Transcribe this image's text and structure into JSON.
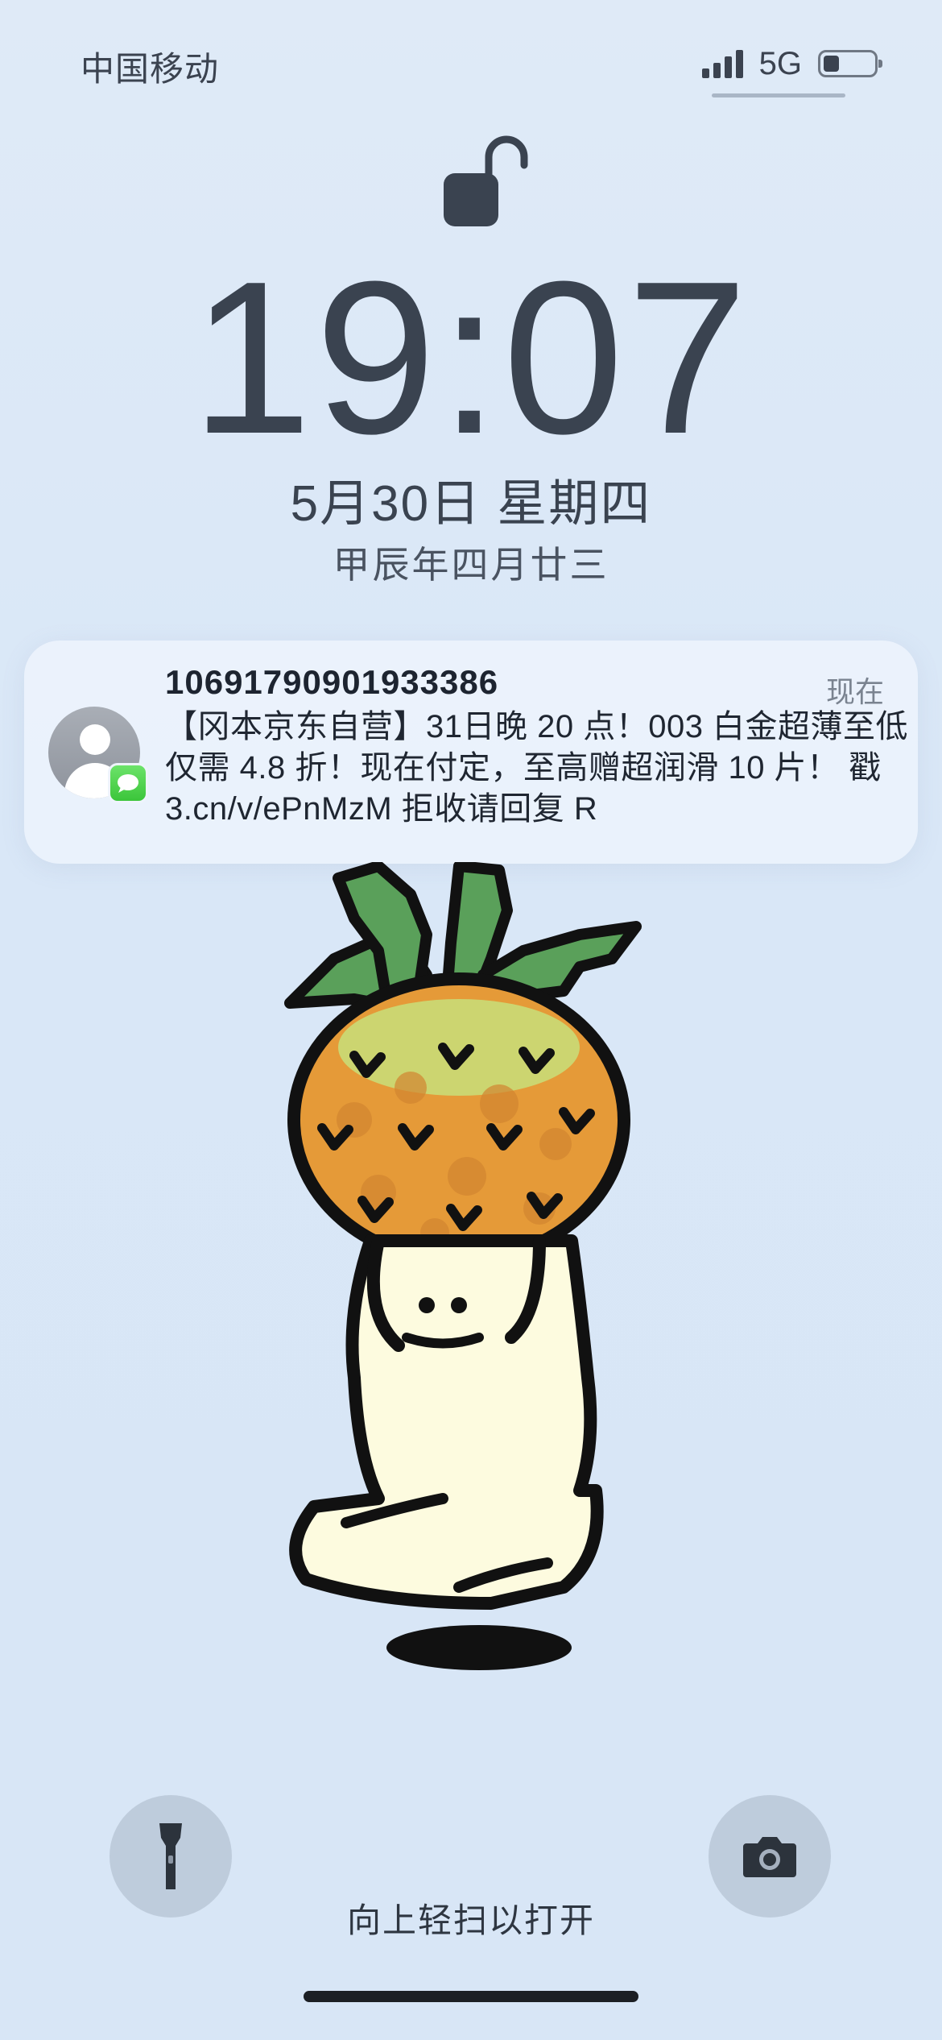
{
  "status_bar": {
    "carrier": "中国移动",
    "network": "5G",
    "battery_level": 0.3,
    "signal_bars": 4
  },
  "lock_screen": {
    "time": "19:07",
    "date": "5月30日 星期四",
    "lunar_date": "甲辰年四月廿三"
  },
  "notification": {
    "sender": "10691790901933386",
    "time": "现在",
    "body": "【冈本京东自营】31日晚 20 点！003 白金超薄至低仅需 4.8 折！现在付定，至高赠超润滑 10 片！ 戳 3.cn/v/ePnMzM  拒收请回复 R",
    "app_icon": "messages-icon",
    "avatar_icon": "person-icon"
  },
  "bottom": {
    "flashlight_icon": "flashlight-icon",
    "camera_icon": "camera-icon",
    "swipe_hint": "向上轻扫以打开"
  },
  "colors": {
    "background": "#dbe8f7",
    "text": "#3a4350",
    "badge_green": "#4cd04a"
  }
}
